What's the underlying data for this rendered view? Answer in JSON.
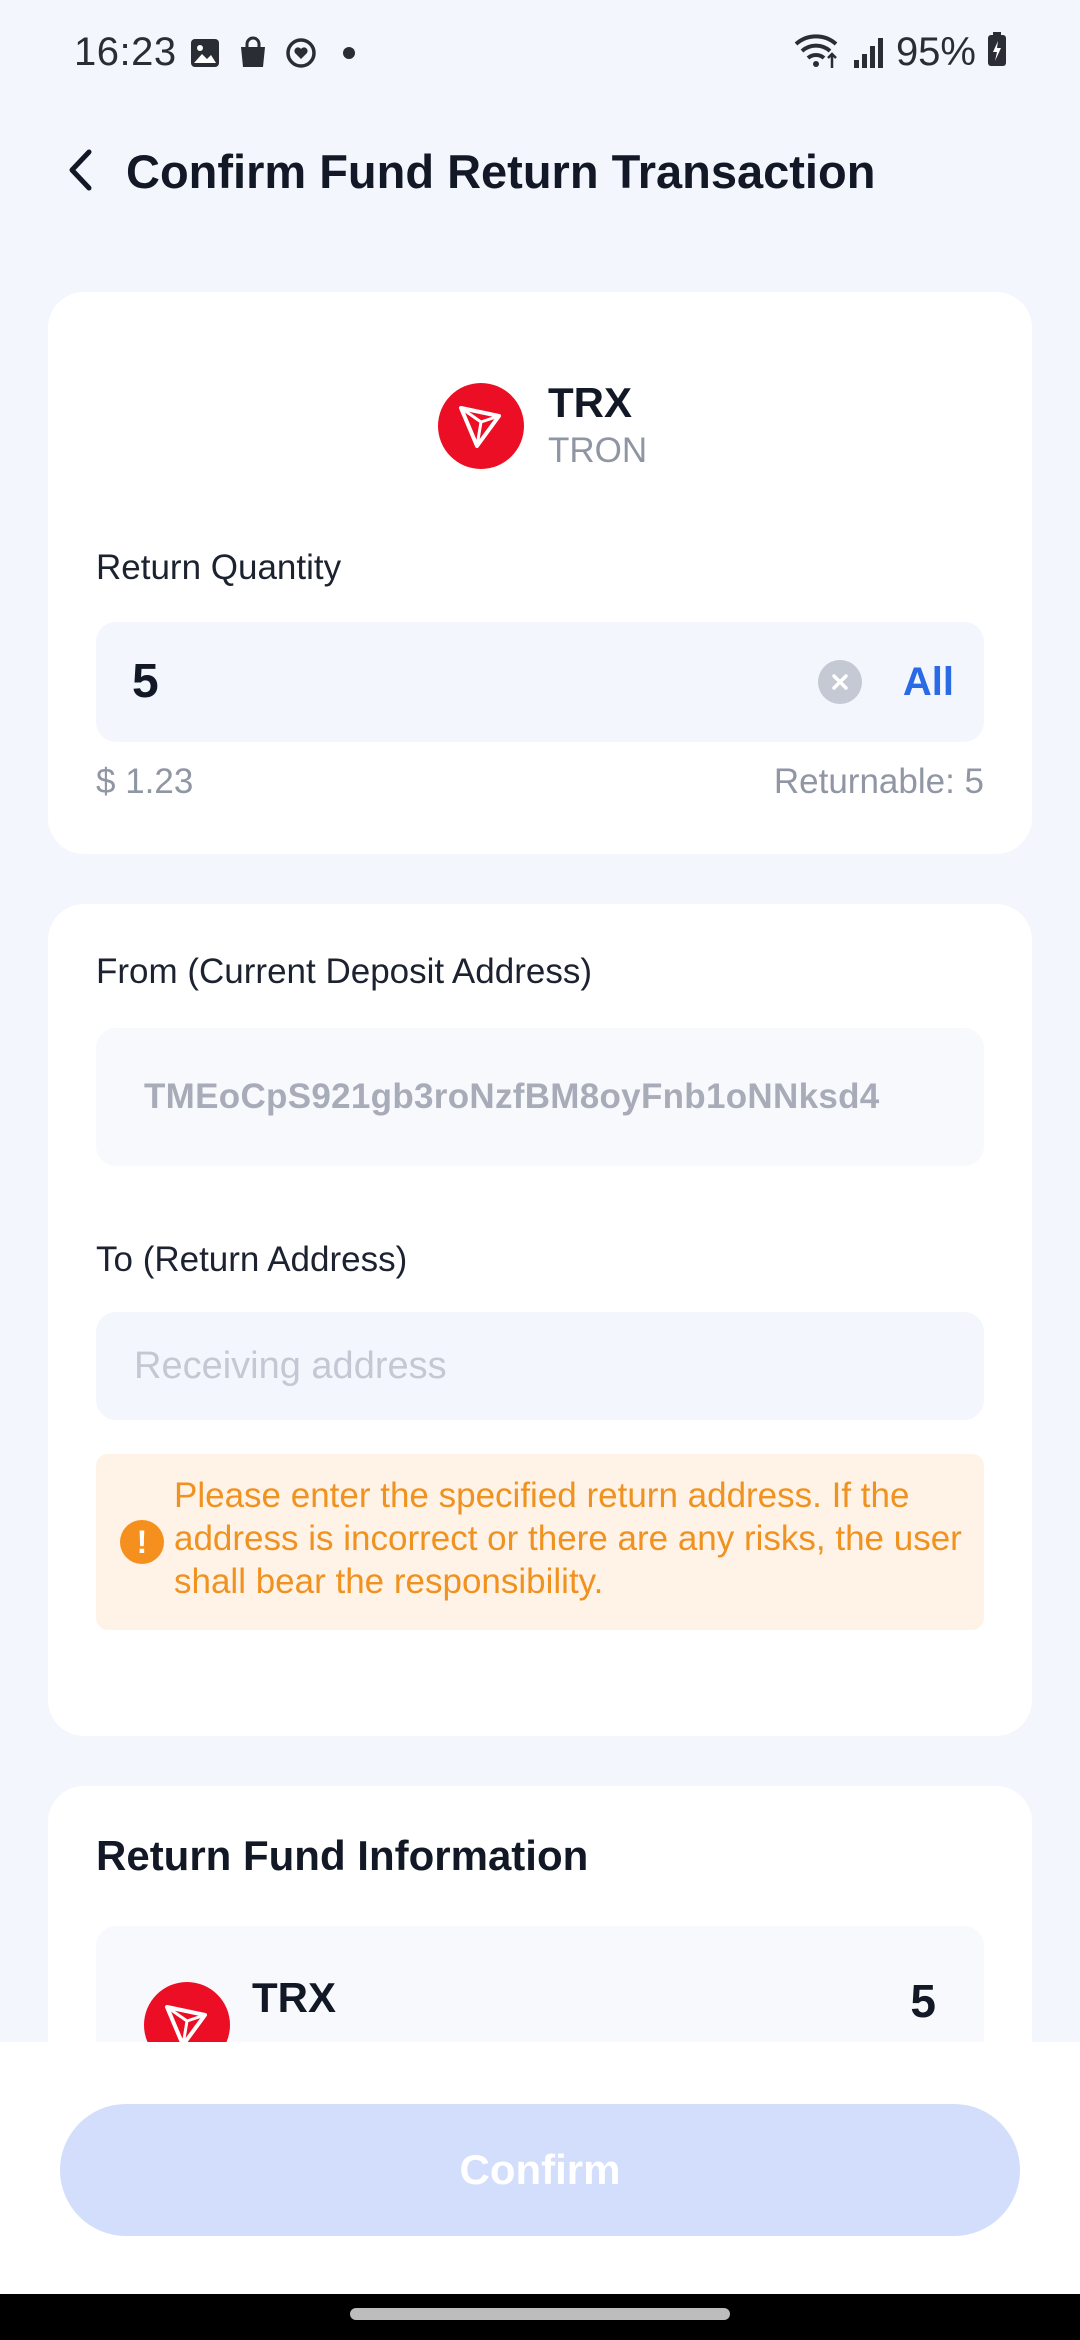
{
  "status_bar": {
    "time": "16:23",
    "battery": "95%",
    "left_icons": [
      "gallery-icon",
      "shopping-bag-icon",
      "heart-circle-icon",
      "dot-icon"
    ],
    "right_icons": [
      "wifi-icon",
      "signal-icon",
      "battery-icon"
    ]
  },
  "header": {
    "title": "Confirm Fund Return Transaction",
    "back_icon": "chevron-left-icon"
  },
  "coin": {
    "symbol": "TRX",
    "name": "TRON",
    "brand_color": "#EC0E24"
  },
  "quantity": {
    "label": "Return Quantity",
    "value": "5",
    "all_label": "All",
    "usd_value": "$ 1.23",
    "returnable": "Returnable: 5"
  },
  "from": {
    "label": "From (Current Deposit Address)",
    "address": "TMEoCpS921gb3roNzfBM8oyFnb1oNNksd4"
  },
  "to": {
    "label": "To (Return Address)",
    "placeholder": "Receiving address",
    "value": ""
  },
  "warning": {
    "text": "Please enter the specified return address. If the address is incorrect or there are any risks, the user shall bear the responsibility.",
    "color": "#F0921F"
  },
  "info": {
    "title": "Return Fund Information",
    "symbol": "TRX",
    "amount": "5"
  },
  "footer": {
    "confirm_label": "Confirm",
    "accent_disabled": "#D2DEFB"
  },
  "colors": {
    "accent": "#2A6BE5",
    "background": "#F3F6FD"
  }
}
